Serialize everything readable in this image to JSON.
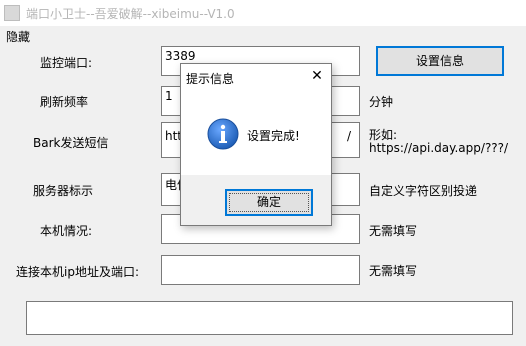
{
  "window": {
    "title": "端口小卫士--吾爱破解--xibeimu--V1.0",
    "menu": "隐藏"
  },
  "form": {
    "port": {
      "label": "监控端口:",
      "value": "3389"
    },
    "interval": {
      "label": "刷新频率",
      "value": "1",
      "unit": "分钟"
    },
    "bark": {
      "label": "Bark发送短信",
      "value": "http",
      "value_tail": "/",
      "hint_line1": "形如:",
      "hint_line2": "https://api.day.app/???/"
    },
    "server": {
      "label": "服务器标示",
      "value": "电信",
      "hint": "自定义字符区别投递"
    },
    "local": {
      "label": "本机情况:",
      "value": "",
      "hint": "无需填写"
    },
    "connect": {
      "label": "连接本机ip地址及端口:",
      "value": "",
      "hint": "无需填写"
    },
    "status_bar": ""
  },
  "buttons": {
    "settings": "设置信息"
  },
  "dialog": {
    "title": "提示信息",
    "close": "✕",
    "icon": "info-icon",
    "message": "设置完成!",
    "ok": "确定"
  },
  "colors": {
    "info_icon": "#1f5fb8",
    "focus_border": "#0078d7"
  }
}
